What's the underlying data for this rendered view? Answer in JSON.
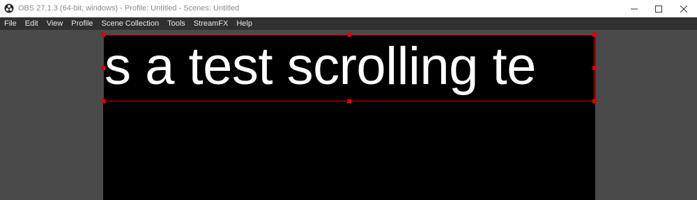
{
  "window": {
    "title": "OBS 27.1.3 (64-bit, windows) - Profile: Untitled - Scenes: Untitled",
    "controls": {
      "minimize": "—",
      "maximize": "☐",
      "close": "✕"
    }
  },
  "menu": {
    "items": [
      {
        "label": "File"
      },
      {
        "label": "Edit"
      },
      {
        "label": "View"
      },
      {
        "label": "Profile"
      },
      {
        "label": "Scene Collection"
      },
      {
        "label": "Tools"
      },
      {
        "label": "StreamFX"
      },
      {
        "label": "Help"
      }
    ]
  },
  "preview": {
    "text_source": "s a test scrolling te"
  },
  "colors": {
    "selection": "#e00000",
    "menubar": "#303030",
    "background": "#4a4a4a",
    "canvas": "#000000"
  },
  "icons": {
    "app": "obs-logo-icon"
  }
}
